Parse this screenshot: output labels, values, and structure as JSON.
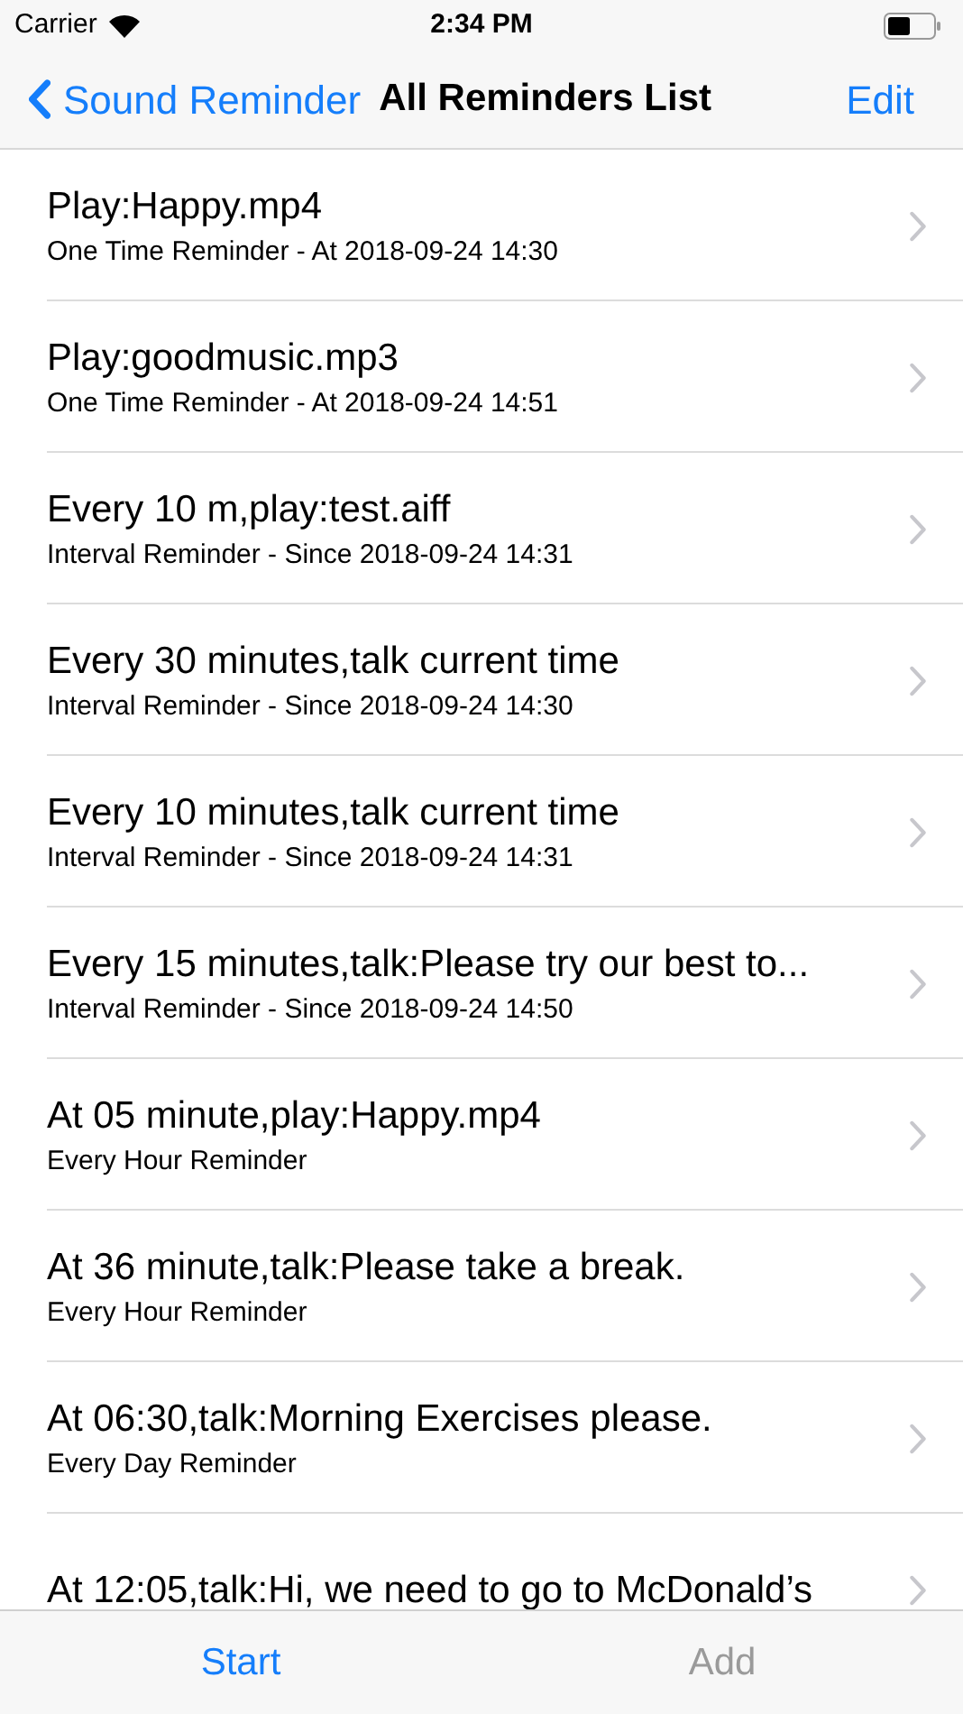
{
  "status_bar": {
    "carrier": "Carrier",
    "time": "2:34 PM"
  },
  "nav": {
    "back": "Sound Reminder",
    "title": "All Reminders List",
    "action": "Edit"
  },
  "reminders": [
    {
      "title": "Play:Happy.mp4",
      "subtitle": "One Time Reminder - At 2018-09-24 14:30"
    },
    {
      "title": "Play:goodmusic.mp3",
      "subtitle": "One Time Reminder - At 2018-09-24 14:51"
    },
    {
      "title": "Every 10 m,play:test.aiff",
      "subtitle": "Interval Reminder - Since 2018-09-24 14:31"
    },
    {
      "title": "Every 30 minutes,talk current time",
      "subtitle": "Interval Reminder - Since 2018-09-24 14:30"
    },
    {
      "title": "Every 10 minutes,talk current time",
      "subtitle": "Interval Reminder - Since 2018-09-24 14:31"
    },
    {
      "title": "Every 15 minutes,talk:Please try our best to...",
      "subtitle": "Interval Reminder - Since 2018-09-24 14:50"
    },
    {
      "title": "At 05 minute,play:Happy.mp4",
      "subtitle": "Every Hour Reminder"
    },
    {
      "title": "At 36 minute,talk:Please take a break.",
      "subtitle": "Every Hour Reminder"
    },
    {
      "title": "At 06:30,talk:Morning Exercises please.",
      "subtitle": "Every Day Reminder"
    },
    {
      "title": "At 12:05,talk:Hi, we need to go to McDonald’s"
    }
  ],
  "toolbar": [
    {
      "label": "Start",
      "disabled": false
    },
    {
      "label": "Add",
      "disabled": true
    }
  ]
}
